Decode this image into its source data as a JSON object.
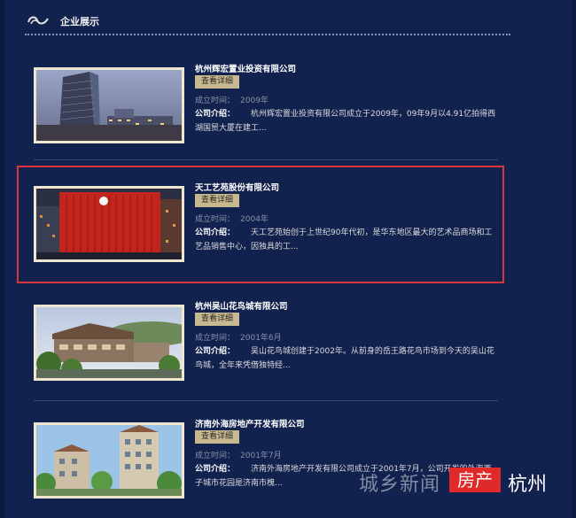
{
  "section_title": "企业展示",
  "button_label": "查看详细",
  "established_label": "成立时间：",
  "intro_label": "公司介绍：",
  "items": [
    {
      "name": "杭州辉宏置业投资有限公司",
      "year": "2009年",
      "intro": "杭州辉宏置业投资有限公司成立于2009年，09年9月以4.91亿拍得西湖国贸大厦在建工..."
    },
    {
      "name": "天工艺苑股份有限公司",
      "year": "2004年",
      "intro": "天工艺苑始创于上世纪90年代初，是华东地区最大的艺术品商场和工艺品销售中心，因独具的工..."
    },
    {
      "name": "杭州吴山花鸟城有限公司",
      "year": "2001年6月",
      "intro": "吴山花鸟城创建于2002年。从前身的岳王路花鸟市场到今天的吴山花鸟城，全年来凭借独特经..."
    },
    {
      "name": "济南外海房地产开发有限公司",
      "year": "2001年7月",
      "intro": "济南外海房地产开发有限公司成立于2001年7月，公司开发的外海西子城市花园是济南市槐..."
    }
  ],
  "watermark": {
    "left_text": "城乡新闻",
    "badge": "房产",
    "city": "杭州"
  },
  "colors": {
    "background": "#12224f",
    "button": "#c8b88f",
    "highlight": "#d8353c"
  }
}
